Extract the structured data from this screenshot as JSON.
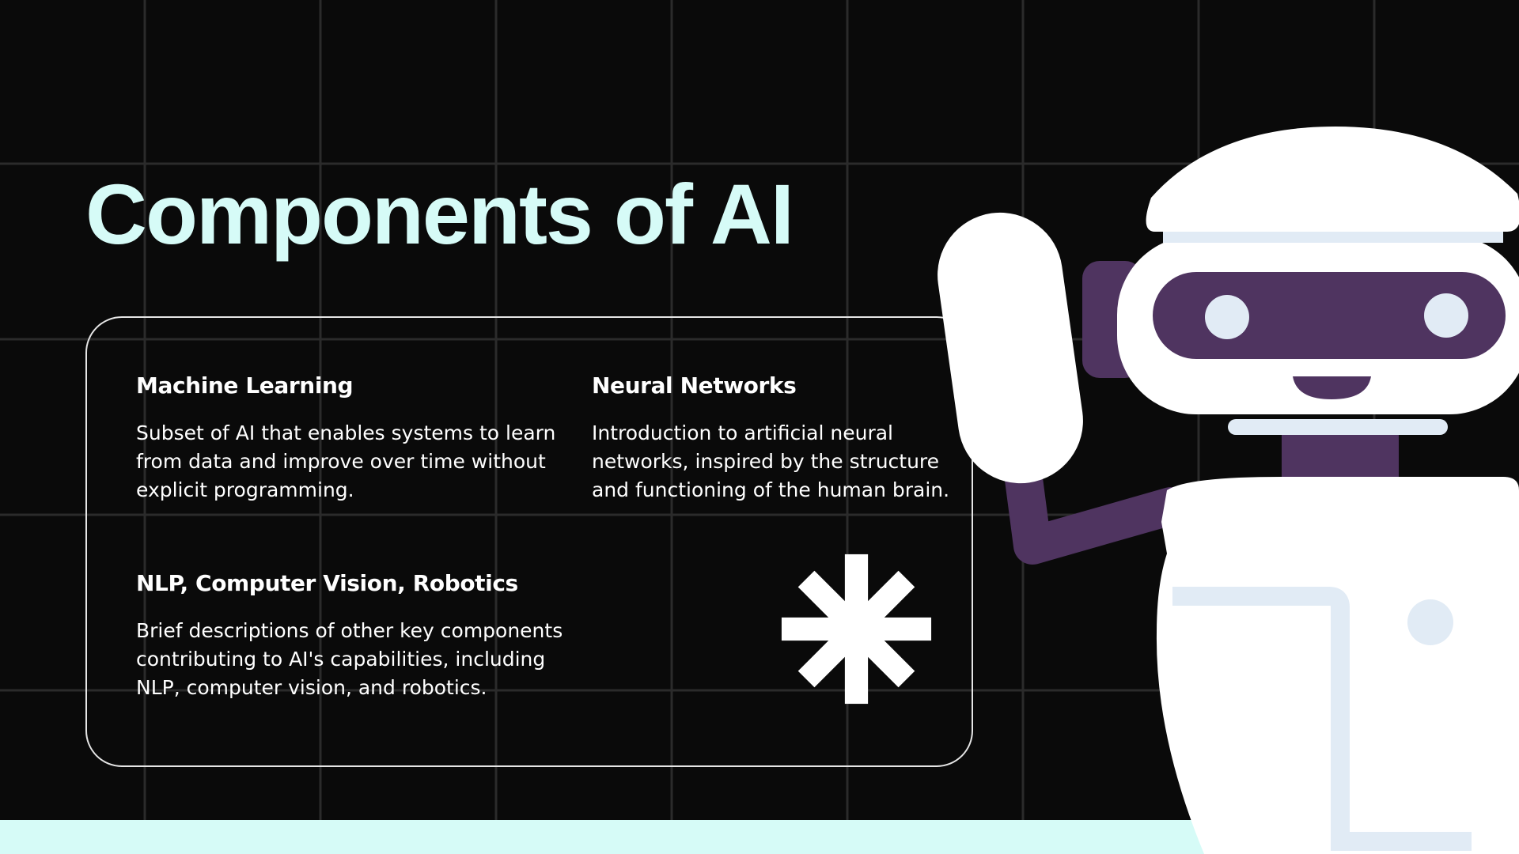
{
  "slide": {
    "title": "Components of AI",
    "colors": {
      "background": "#0a0a0a",
      "grid": "#2b2b2b",
      "accent": "#d6fbf7",
      "robot_purple": "#4f3460",
      "robot_body": "#ffffff",
      "robot_trim": "#e1ebf5"
    }
  },
  "items": [
    {
      "heading": "Machine Learning",
      "text": "Subset of AI that enables systems to learn from data and improve over time without explicit programming."
    },
    {
      "heading": "Neural Networks",
      "text": "Introduction to artificial neural networks, inspired by the structure and functioning of the human brain."
    },
    {
      "heading": "NLP, Computer Vision, Robotics",
      "text": "Brief descriptions of other key components contributing to AI's capabilities, including NLP, computer vision, and robotics."
    }
  ],
  "icons": {
    "decoration": "asterisk-icon",
    "illustration": "robot-waving-illustration"
  }
}
